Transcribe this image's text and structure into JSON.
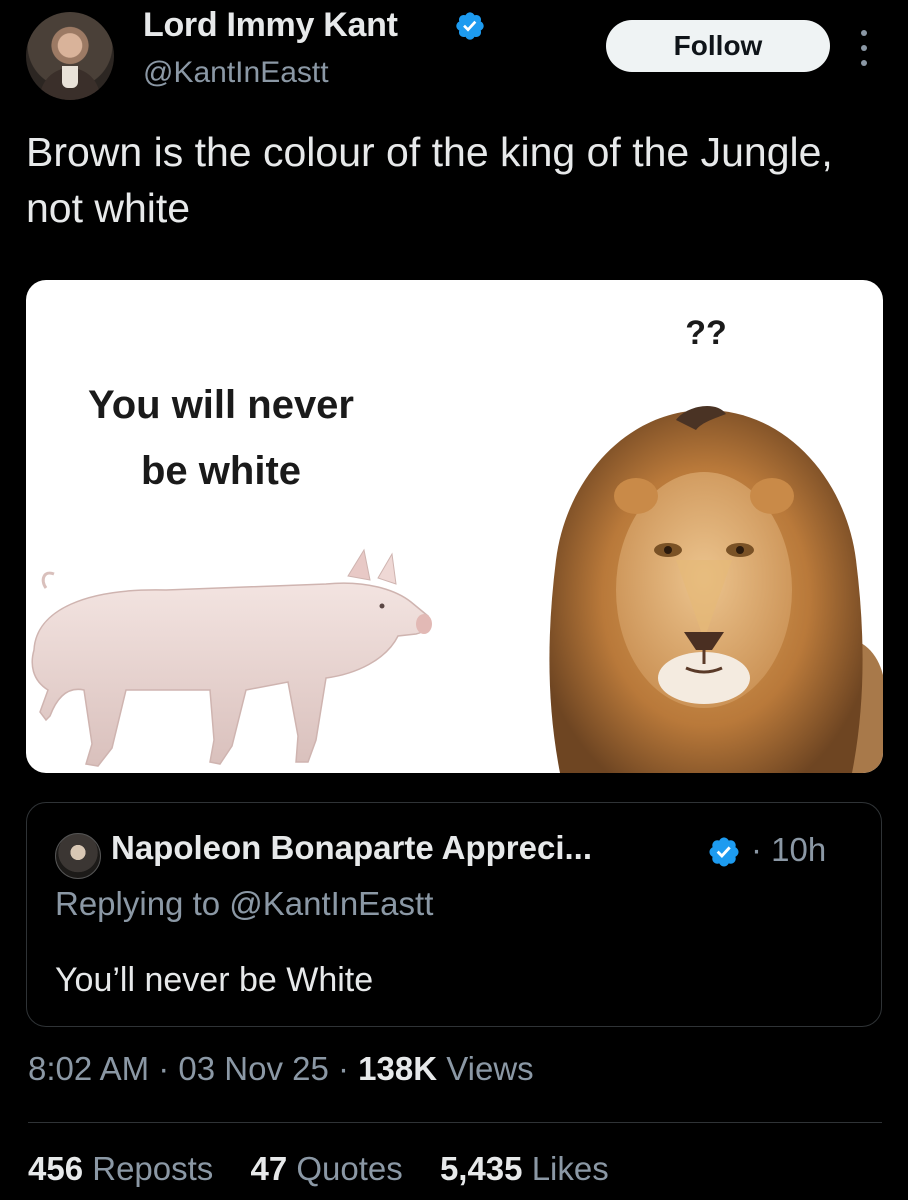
{
  "author": {
    "name": "Lord Immy Kant",
    "handle": "@KantInEastt"
  },
  "actions": {
    "follow_label": "Follow"
  },
  "tweet": {
    "text": "Brown is the colour of the king of the Jungle, not white"
  },
  "media": {
    "caption_left_line1": "You will never",
    "caption_left_line2": "be white",
    "caption_right": "??"
  },
  "quote": {
    "name": "Napoleon Bonaparte Appreci...",
    "time": "· 10h",
    "replying": "Replying to @KantInEastt",
    "text": "You’ll never be White"
  },
  "meta": {
    "time": "8:02 AM",
    "sep1": " · ",
    "date": "03 Nov 25",
    "sep2": " · ",
    "views_count": "138K",
    "views_label": " Views"
  },
  "stats": {
    "reposts_count": "456",
    "reposts_label": " Reposts",
    "quotes_count": "47",
    "quotes_label": " Quotes",
    "likes_count": "5,435",
    "likes_label": " Likes"
  },
  "colors": {
    "background": "#000000",
    "text": "#e7e9ea",
    "secondary": "#8b98a5",
    "verified": "#1d9bf0"
  }
}
